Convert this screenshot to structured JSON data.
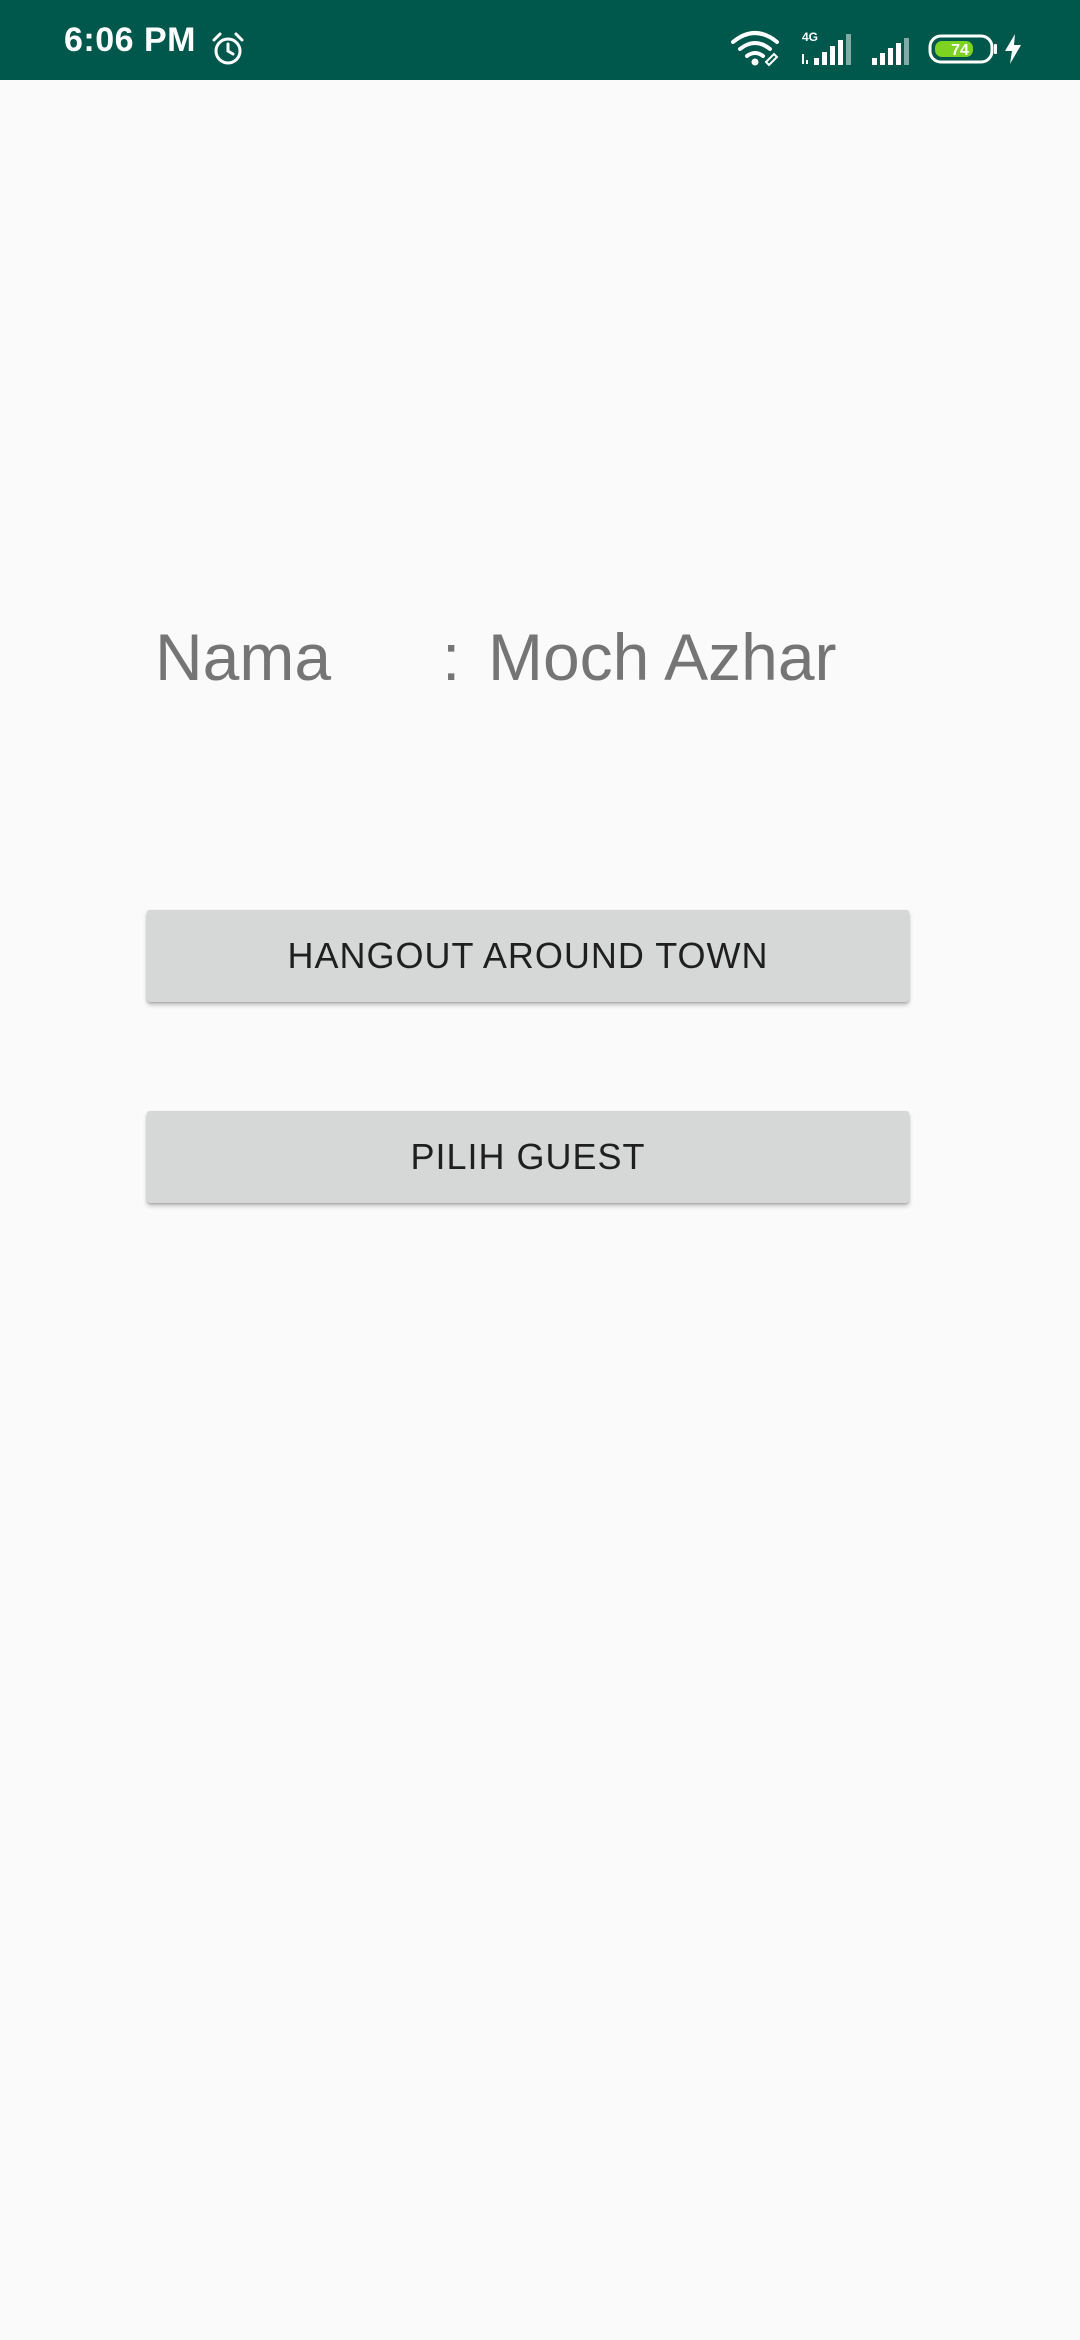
{
  "status_bar": {
    "time": "6:06 PM",
    "network_type": "4G",
    "battery_level": "74",
    "alarm_icon": "alarm-clock-icon",
    "wifi_icon": "wifi-icon",
    "signal_icon": "signal-bars-icon",
    "battery_icon": "battery-icon",
    "charging_icon": "lightning-bolt-icon",
    "background_color": "#00574b",
    "battery_fill_color": "#7ed321"
  },
  "profile": {
    "name_label": "Nama",
    "separator": ":",
    "name_value": "Moch Azhar"
  },
  "actions": {
    "hangout_label": "HANGOUT AROUND TOWN",
    "guest_label": "PILIH GUEST"
  }
}
